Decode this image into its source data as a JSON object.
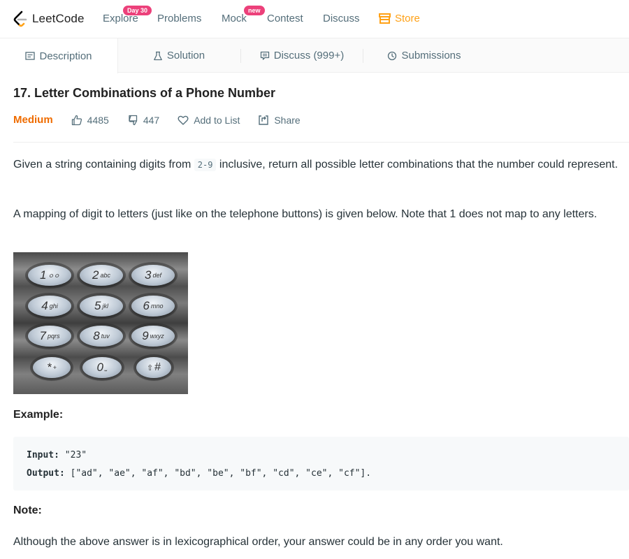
{
  "nav": {
    "logo_text": "LeetCode",
    "items": [
      {
        "label": "Explore",
        "badge": "Day 30"
      },
      {
        "label": "Problems"
      },
      {
        "label": "Mock",
        "badge": "new"
      },
      {
        "label": "Contest"
      },
      {
        "label": "Discuss"
      },
      {
        "label": "Store",
        "icon": "store-icon"
      }
    ],
    "accent_color": "#ffa116",
    "badge_color": "#ec407a"
  },
  "tabs": [
    {
      "label": "Description",
      "icon": "description-icon",
      "active": true
    },
    {
      "label": "Solution",
      "icon": "flask-icon"
    },
    {
      "label": "Discuss (999+)",
      "icon": "comment-icon"
    },
    {
      "label": "Submissions",
      "icon": "clock-icon"
    }
  ],
  "question": {
    "title": "17. Letter Combinations of a Phone Number",
    "difficulty": "Medium",
    "difficulty_color": "#ef6c00",
    "likes": "4485",
    "dislikes": "447",
    "add_to_list": "Add to List",
    "share": "Share"
  },
  "description": {
    "p1_before": "Given a string containing digits from ",
    "p1_code": "2-9",
    "p1_after": " inclusive, return all possible letter combinations that the number could represent.",
    "p2": "A mapping of digit to letters (just like on the telephone buttons) is given below. Note that 1 does not map to any letters.",
    "keypad": [
      {
        "digit": "1",
        "letters": "ㅇㅇ"
      },
      {
        "digit": "2",
        "letters": "abc"
      },
      {
        "digit": "3",
        "letters": "def"
      },
      {
        "digit": "4",
        "letters": "ghi"
      },
      {
        "digit": "5",
        "letters": "jkl"
      },
      {
        "digit": "6",
        "letters": "mno"
      },
      {
        "digit": "7",
        "letters": "pqrs"
      },
      {
        "digit": "8",
        "letters": "tuv"
      },
      {
        "digit": "9",
        "letters": "wxyz"
      },
      {
        "digit": "*",
        "letters": "+"
      },
      {
        "digit": "0",
        "letters": "⎵"
      },
      {
        "digit": "⇧",
        "letters": "#"
      }
    ],
    "example_title": "Example:",
    "input_label": "Input:",
    "input_value": " \"23\"",
    "output_label": "Output:",
    "output_value": " [\"ad\", \"ae\", \"af\", \"bd\", \"be\", \"bf\", \"cd\", \"ce\", \"cf\"].",
    "note_title": "Note:",
    "note_text": "Although the above answer is in lexicographical order, your answer could be in any order you want."
  }
}
